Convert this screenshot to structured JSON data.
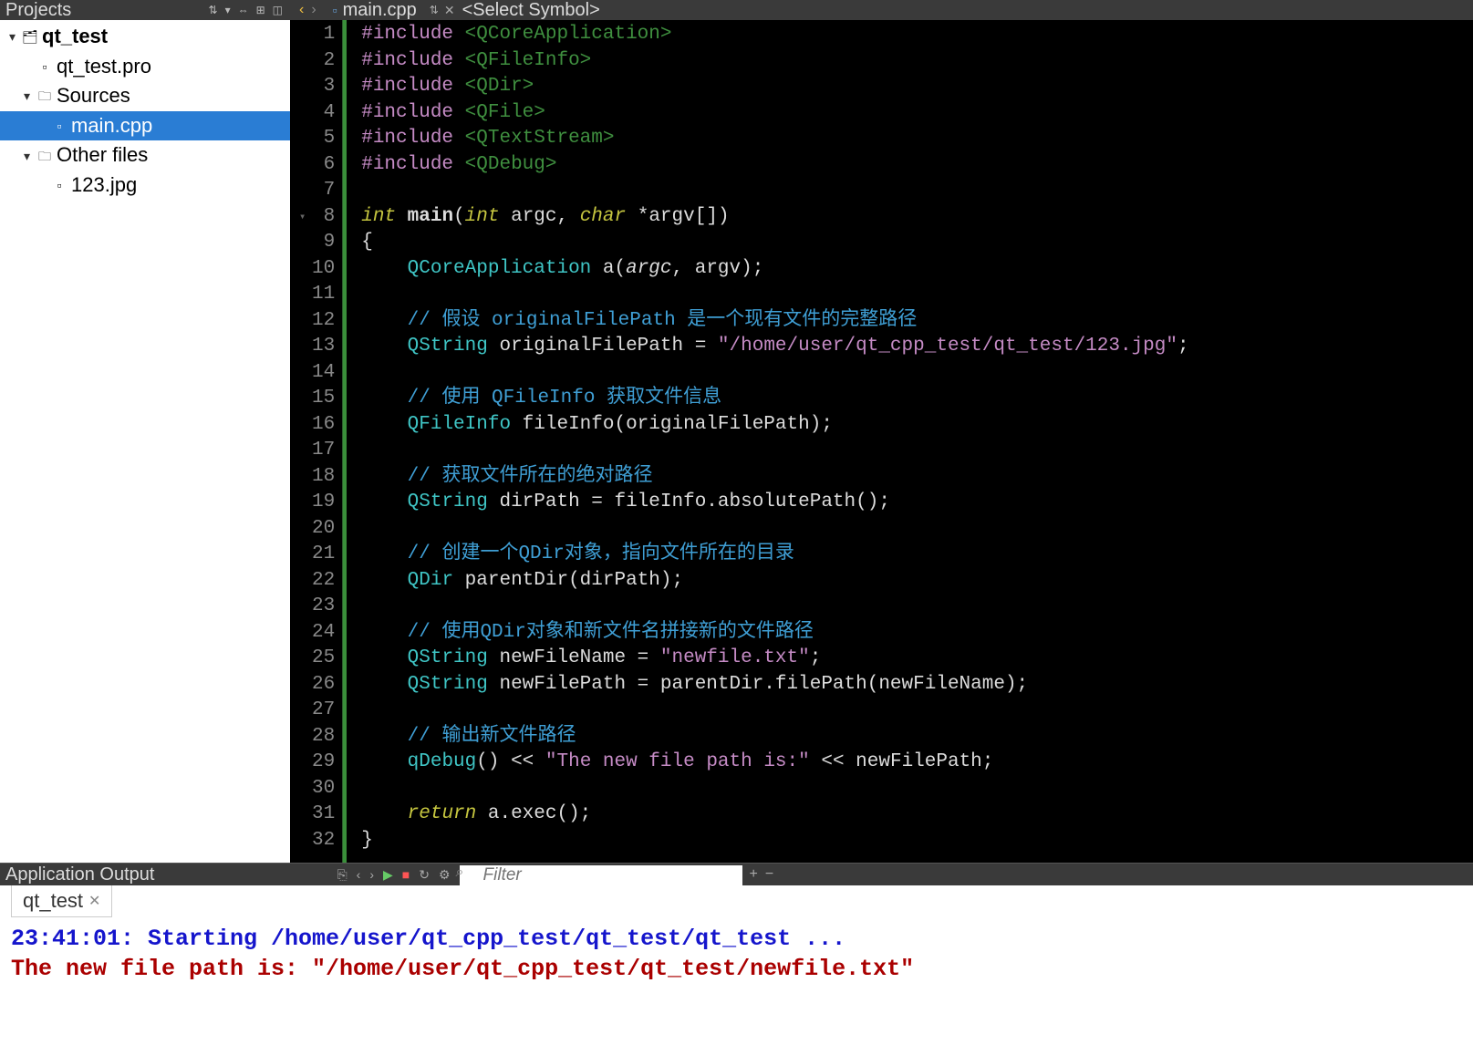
{
  "sidebar": {
    "title": "Projects",
    "tree": {
      "root": {
        "label": "qt_test"
      },
      "pro": {
        "label": "qt_test.pro"
      },
      "sources": {
        "label": "Sources"
      },
      "main": {
        "label": "main.cpp"
      },
      "other": {
        "label": "Other files"
      },
      "img": {
        "label": "123.jpg"
      }
    }
  },
  "editor": {
    "tab_filename": "main.cpp",
    "symbol_selector": "<Select Symbol>"
  },
  "code": {
    "lines": [
      {
        "n": 1,
        "html": "<span class='kw-pp'>#include</span> <span class='inc'>&lt;QCoreApplication&gt;</span>"
      },
      {
        "n": 2,
        "html": "<span class='kw-pp'>#include</span> <span class='inc'>&lt;QFileInfo&gt;</span>"
      },
      {
        "n": 3,
        "html": "<span class='kw-pp'>#include</span> <span class='inc'>&lt;QDir&gt;</span>"
      },
      {
        "n": 4,
        "html": "<span class='kw-pp'>#include</span> <span class='inc'>&lt;QFile&gt;</span>"
      },
      {
        "n": 5,
        "html": "<span class='kw-pp'>#include</span> <span class='inc'>&lt;QTextStream&gt;</span>"
      },
      {
        "n": 6,
        "html": "<span class='kw-pp'>#include</span> <span class='inc'>&lt;QDebug&gt;</span>"
      },
      {
        "n": 7,
        "html": ""
      },
      {
        "n": 8,
        "html": "<span class='kw'>int</span> <span class='fn'>main</span>(<span class='kw'>int</span> argc, <span class='kw'>char</span> *argv[])",
        "fold": true
      },
      {
        "n": 9,
        "html": "{"
      },
      {
        "n": 10,
        "html": "    <span class='type'>QCoreApplication</span> a(<span class='param'>argc</span>, argv);"
      },
      {
        "n": 11,
        "html": ""
      },
      {
        "n": 12,
        "html": "    <span class='cmt'>// 假设 originalFilePath 是一个现有文件的完整路径</span>"
      },
      {
        "n": 13,
        "html": "    <span class='type'>QString</span> originalFilePath = <span class='str'>\"/home/user/qt_cpp_test/qt_test/123.jpg\"</span>;"
      },
      {
        "n": 14,
        "html": ""
      },
      {
        "n": 15,
        "html": "    <span class='cmt'>// 使用 QFileInfo 获取文件信息</span>"
      },
      {
        "n": 16,
        "html": "    <span class='type'>QFileInfo</span> fileInfo(originalFilePath);"
      },
      {
        "n": 17,
        "html": ""
      },
      {
        "n": 18,
        "html": "    <span class='cmt'>// 获取文件所在的绝对路径</span>"
      },
      {
        "n": 19,
        "html": "    <span class='type'>QString</span> dirPath = fileInfo.absolutePath();"
      },
      {
        "n": 20,
        "html": ""
      },
      {
        "n": 21,
        "html": "    <span class='cmt'>// 创建一个QDir对象，指向文件所在的目录</span>"
      },
      {
        "n": 22,
        "html": "    <span class='type'>QDir</span> parentDir(dirPath);"
      },
      {
        "n": 23,
        "html": ""
      },
      {
        "n": 24,
        "html": "    <span class='cmt'>// 使用QDir对象和新文件名拼接新的文件路径</span>"
      },
      {
        "n": 25,
        "html": "    <span class='type'>QString</span> newFileName = <span class='str'>\"newfile.txt\"</span>;"
      },
      {
        "n": 26,
        "html": "    <span class='type'>QString</span> newFilePath = parentDir.filePath(newFileName);"
      },
      {
        "n": 27,
        "html": ""
      },
      {
        "n": 28,
        "html": "    <span class='cmt'>// 输出新文件路径</span>"
      },
      {
        "n": 29,
        "html": "    <span class='type'>qDebug</span>() &lt;&lt; <span class='str'>\"The new file path is:\"</span> &lt;&lt; newFilePath;"
      },
      {
        "n": 30,
        "html": ""
      },
      {
        "n": 31,
        "html": "    <span class='kw'>return</span> a.exec();"
      },
      {
        "n": 32,
        "html": "}"
      }
    ]
  },
  "output": {
    "title": "Application Output",
    "filter_placeholder": "Filter",
    "tab": "qt_test",
    "line1": "23:41:01: Starting /home/user/qt_cpp_test/qt_test/qt_test ...",
    "line2": "The new file path is: \"/home/user/qt_cpp_test/qt_test/newfile.txt\""
  }
}
